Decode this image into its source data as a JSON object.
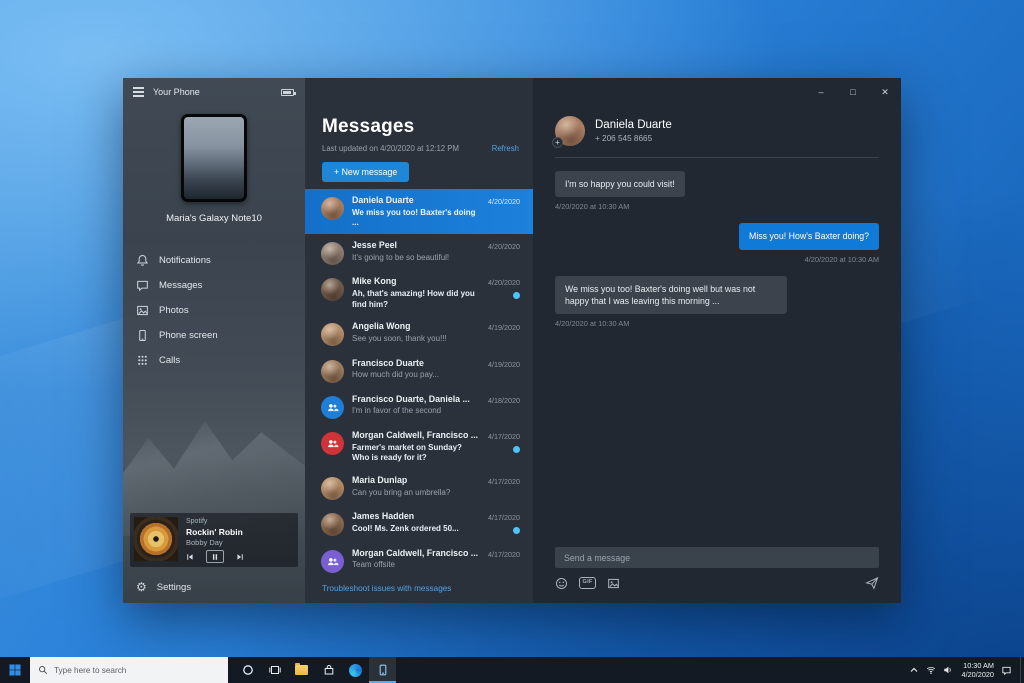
{
  "colors": {
    "accent": "#1e87d8",
    "selected_conversation": "#1878d1",
    "unread_dot": "#4fc3f7",
    "sent_bubble": "#0f7ad8",
    "received_bubble": "#3c434d",
    "link": "#4ea3e8",
    "taskbar": "#141a23"
  },
  "window": {
    "titlebar": {
      "title": "Your Phone",
      "battery_icon": "battery-icon",
      "minimize_glyph": "–",
      "maximize_glyph": "□",
      "close_glyph": "✕"
    },
    "sidebar": {
      "device_name": "Maria's Galaxy Note10",
      "nav": [
        {
          "label": "Notifications",
          "icon": "bell-icon"
        },
        {
          "label": "Messages",
          "icon": "chat-icon"
        },
        {
          "label": "Photos",
          "icon": "image-icon"
        },
        {
          "label": "Phone screen",
          "icon": "phone-icon"
        },
        {
          "label": "Calls",
          "icon": "dialpad-icon"
        }
      ],
      "player": {
        "app": "Spotify",
        "track": "Rockin' Robin",
        "artist": "Bobby Day",
        "controls": [
          "previous",
          "pause",
          "next"
        ]
      },
      "settings_label": "Settings",
      "settings_icon_glyph": "⚙"
    },
    "messages_panel": {
      "title": "Messages",
      "last_updated": "Last updated on 4/20/2020 at 12:12 PM",
      "refresh_label": "Refresh",
      "new_message_label": "+ New message",
      "troubleshoot_link": "Troubleshoot issues with messages",
      "conversations": [
        {
          "name": "Daniela Duarte",
          "preview": "We miss you too! Baxter's doing ...",
          "date": "4/20/2020",
          "avatar_color": "#a87e63",
          "avatar_type": "photo",
          "selected": true,
          "unread": false
        },
        {
          "name": "Jesse Peel",
          "preview": "It's going to be so beautiful!",
          "date": "4/20/2020",
          "avatar_color": "#8d7d72",
          "avatar_type": "photo",
          "selected": false,
          "unread": false
        },
        {
          "name": "Mike Kong",
          "preview": "Ah, that's amazing! How did you find him?",
          "date": "4/20/2020",
          "avatar_color": "#6e594a",
          "avatar_type": "photo",
          "selected": false,
          "unread": true
        },
        {
          "name": "Angelia Wong",
          "preview": "See you soon, thank you!!!",
          "date": "4/19/2020",
          "avatar_color": "#b48e6c",
          "avatar_type": "photo",
          "selected": false,
          "unread": false
        },
        {
          "name": "Francisco Duarte",
          "preview": "How much did you pay...",
          "date": "4/19/2020",
          "avatar_color": "#9a7a60",
          "avatar_type": "photo",
          "selected": false,
          "unread": false
        },
        {
          "name": "Francisco Duarte, Daniela ...",
          "preview": "I'm in favor of the second",
          "date": "4/18/2020",
          "avatar_color": "#1f7ed6",
          "avatar_type": "group",
          "selected": false,
          "unread": false
        },
        {
          "name": "Morgan Caldwell, Francisco ...",
          "preview": "Farmer's market on Sunday? Who is ready for it?",
          "date": "4/17/2020",
          "avatar_color": "#d13438",
          "avatar_type": "group",
          "selected": false,
          "unread": true
        },
        {
          "name": "Maria Dunlap",
          "preview": "Can you bring an umbrella?",
          "date": "4/17/2020",
          "avatar_color": "#b18a66",
          "avatar_type": "photo",
          "selected": false,
          "unread": false
        },
        {
          "name": "James Hadden",
          "preview": "Cool! Ms. Zenk ordered 50...",
          "date": "4/17/2020",
          "avatar_color": "#87684f",
          "avatar_type": "photo",
          "selected": false,
          "unread": true
        },
        {
          "name": "Morgan Caldwell, Francisco ...",
          "preview": "Team offsite",
          "date": "4/17/2020",
          "avatar_color": "#7a5fd2",
          "avatar_type": "group",
          "selected": false,
          "unread": false
        }
      ]
    },
    "thread": {
      "contact_name": "Daniela Duarte",
      "contact_number": "+ 206 545 8665",
      "avatar_color": "#a87e63",
      "badge_glyph": "+",
      "messages": [
        {
          "direction": "received",
          "text": "I'm so happy you could visit!",
          "timestamp": "4/20/2020 at 10:30 AM"
        },
        {
          "direction": "sent",
          "text": "Miss you! How's Baxter doing?",
          "timestamp": "4/20/2020 at 10:30 AM"
        },
        {
          "direction": "received",
          "text": "We miss you too! Baxter's doing well but was not happy that I was leaving this morning ...",
          "timestamp": "4/20/2020 at 10:30 AM"
        }
      ],
      "composer": {
        "placeholder": "Send a message",
        "gif_label": "GIF",
        "icons": [
          "emoji-icon",
          "gif-icon",
          "image-attach-icon",
          "send-icon"
        ]
      }
    }
  },
  "taskbar": {
    "search_placeholder": "Type here to search",
    "clock": {
      "time": "10:30 AM",
      "date": "4/20/2020"
    },
    "icons": [
      "start",
      "search",
      "cortana",
      "task-view",
      "file-explorer",
      "store",
      "edge",
      "your-phone"
    ],
    "active_app": "your-phone"
  }
}
